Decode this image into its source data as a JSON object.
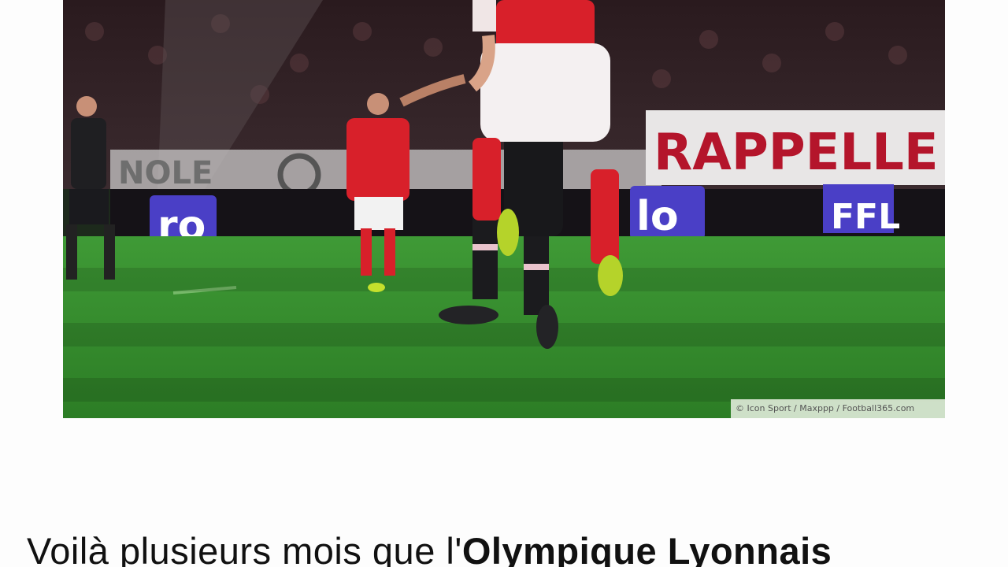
{
  "article": {
    "photo": {
      "description_icon": "photo-image",
      "credit": "© Icon Sport / Maxppp / Football365.com",
      "banners": {
        "rappelle": "RAPPELLE",
        "ro": "ro",
        "lo": "lo",
        "ffl": "FFL",
        "nole": "NOLE"
      }
    },
    "text": {
      "before": "Voilà plusieurs mois que l'",
      "bold": "Olympique Lyonnais"
    }
  },
  "colors": {
    "pitch": "#2f8a2a",
    "team_red": "#d8202a",
    "page_bg": "#fdfdfd"
  }
}
